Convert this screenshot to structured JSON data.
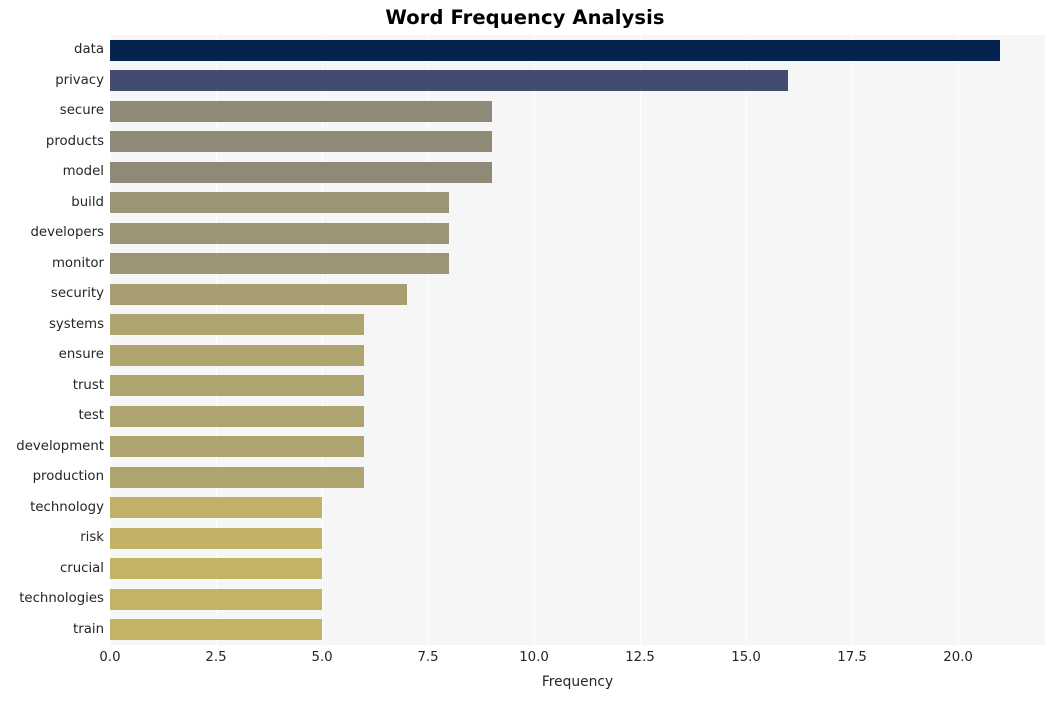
{
  "chart_data": {
    "type": "bar",
    "orientation": "horizontal",
    "title": "Word Frequency Analysis",
    "xlabel": "Frequency",
    "ylabel": "",
    "categories": [
      "data",
      "privacy",
      "secure",
      "products",
      "model",
      "build",
      "developers",
      "monitor",
      "security",
      "systems",
      "ensure",
      "trust",
      "test",
      "development",
      "production",
      "technology",
      "risk",
      "crucial",
      "technologies",
      "train"
    ],
    "values": [
      21,
      16,
      9,
      9,
      9,
      8,
      8,
      8,
      7,
      6,
      6,
      6,
      6,
      6,
      6,
      5,
      5,
      5,
      5,
      5
    ],
    "bar_colors": [
      "#04244f",
      "#414c6e",
      "#8d8a78",
      "#8f8b78",
      "#8e8a77",
      "#9c9473",
      "#9c9473",
      "#9c9472",
      "#a79d70",
      "#ada470",
      "#ada470",
      "#ada470",
      "#ada470",
      "#ada470",
      "#ada470",
      "#c0b166",
      "#c1b266",
      "#c2b365",
      "#c3b465",
      "#c3b465"
    ],
    "xlim": [
      0,
      22.05
    ],
    "xticks": [
      "0.0",
      "2.5",
      "5.0",
      "7.5",
      "10.0",
      "12.5",
      "15.0",
      "17.5",
      "20.0"
    ],
    "xtick_values": [
      0,
      2.5,
      5,
      7.5,
      10,
      12.5,
      15,
      17.5,
      20
    ],
    "grid": true,
    "grid_axis": "x",
    "grid_color": "#ffffff",
    "plot_background": "#f6f6f6",
    "figure_background": "#ffffff",
    "legend": "none",
    "title_color": "#000000",
    "tick_label_color": "#262626"
  }
}
